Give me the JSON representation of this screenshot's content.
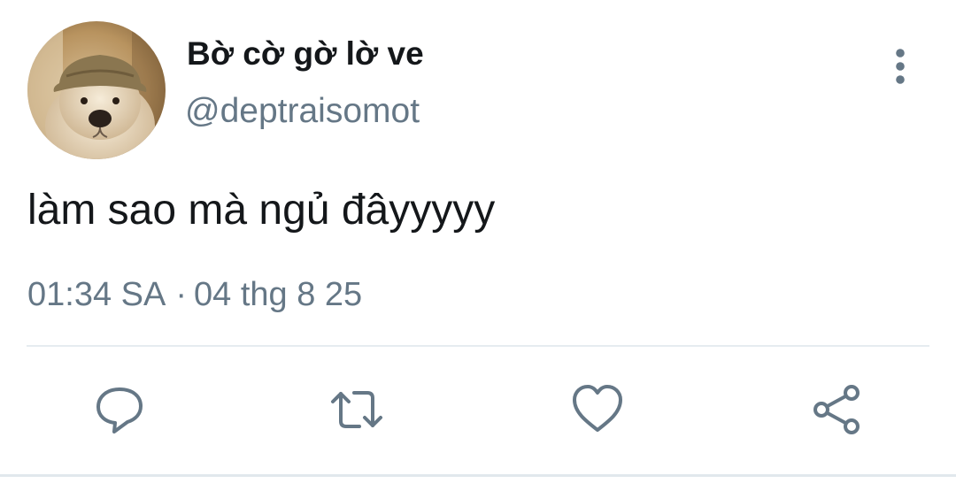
{
  "tweet": {
    "author": {
      "display_name": "Bờ cờ gờ lờ ve",
      "handle": "@deptraisomot",
      "avatar": "dog-with-bucket-hat-avatar"
    },
    "text": "làm sao mà ngủ đâyyyyy",
    "time": "01:34 SA",
    "separator": "·",
    "date": "04 thg 8 25"
  },
  "actions": {
    "reply": "reply-icon",
    "retweet": "retweet-icon",
    "like": "heart-icon",
    "share": "share-icon"
  },
  "menu": {
    "icon": "more-vertical-icon"
  },
  "colors": {
    "text_primary": "#14171a",
    "text_secondary": "#657786",
    "divider": "#e6ecf0"
  }
}
